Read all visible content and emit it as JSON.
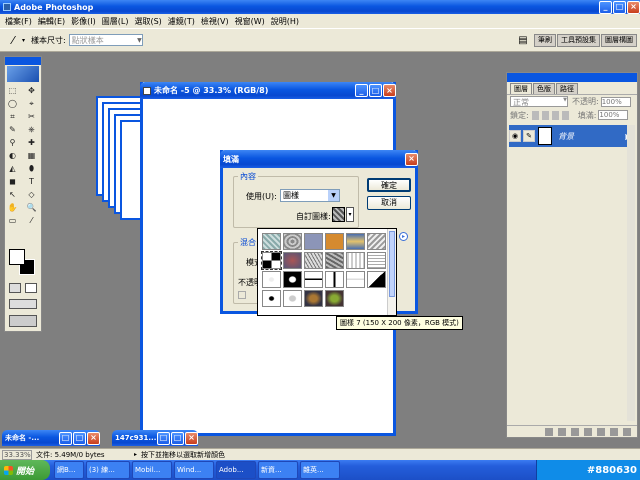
{
  "app": {
    "title": "Adobe Photoshop"
  },
  "menu": [
    "檔案(F)",
    "編輯(E)",
    "影像(I)",
    "圖層(L)",
    "選取(S)",
    "濾鏡(T)",
    "檢視(V)",
    "視窗(W)",
    "說明(H)"
  ],
  "options": {
    "sample_label": "樣本尺寸:",
    "sample_value": "點狀樣本",
    "tabs": [
      "筆刷",
      "工具預設集",
      "圖層構圖"
    ]
  },
  "doc": {
    "title": "未命名 -5 @ 33.3% (RGB/8)"
  },
  "dialog": {
    "title": "填滿",
    "content_group": "內容",
    "use_label": "使用(U):",
    "use_value": "圖樣",
    "custom_pattern_label": "自訂圖樣:",
    "blend_group": "混合",
    "mode_label": "模式",
    "opacity_label": "不透明",
    "ok_label": "確定",
    "cancel_label": "取消"
  },
  "tooltip": "圖樣 7 (150 X 200 像素，RGB 模式)",
  "layers_panel": {
    "tabs": [
      "圖層",
      "色版",
      "路徑"
    ],
    "mode": "正常",
    "opacity_label": "不透明:",
    "opacity_value": "100%",
    "lock_label": "鎖定:",
    "fill_label": "填滿:",
    "fill_value": "100%",
    "layer_name": "背景"
  },
  "minimized": [
    {
      "title": "未命名 -..."
    },
    {
      "title": "147c931..."
    }
  ],
  "status": {
    "zoom": "33.33%",
    "doc_info": "文件: 5.49M/0 bytes",
    "hint": "按下並拖移以選取新增顏色"
  },
  "taskbar": {
    "start": "開始",
    "items": [
      "(3) 練...",
      "Mobil...",
      "Wind...",
      "Adob...",
      "新資...",
      "雜英..."
    ],
    "first": "網B...",
    "watermark": "#880630"
  },
  "colors": {
    "accent": "#0a56e0",
    "taskbar": "#245edb",
    "start": "#3c9a35",
    "desktop": "#7f7f7f"
  }
}
